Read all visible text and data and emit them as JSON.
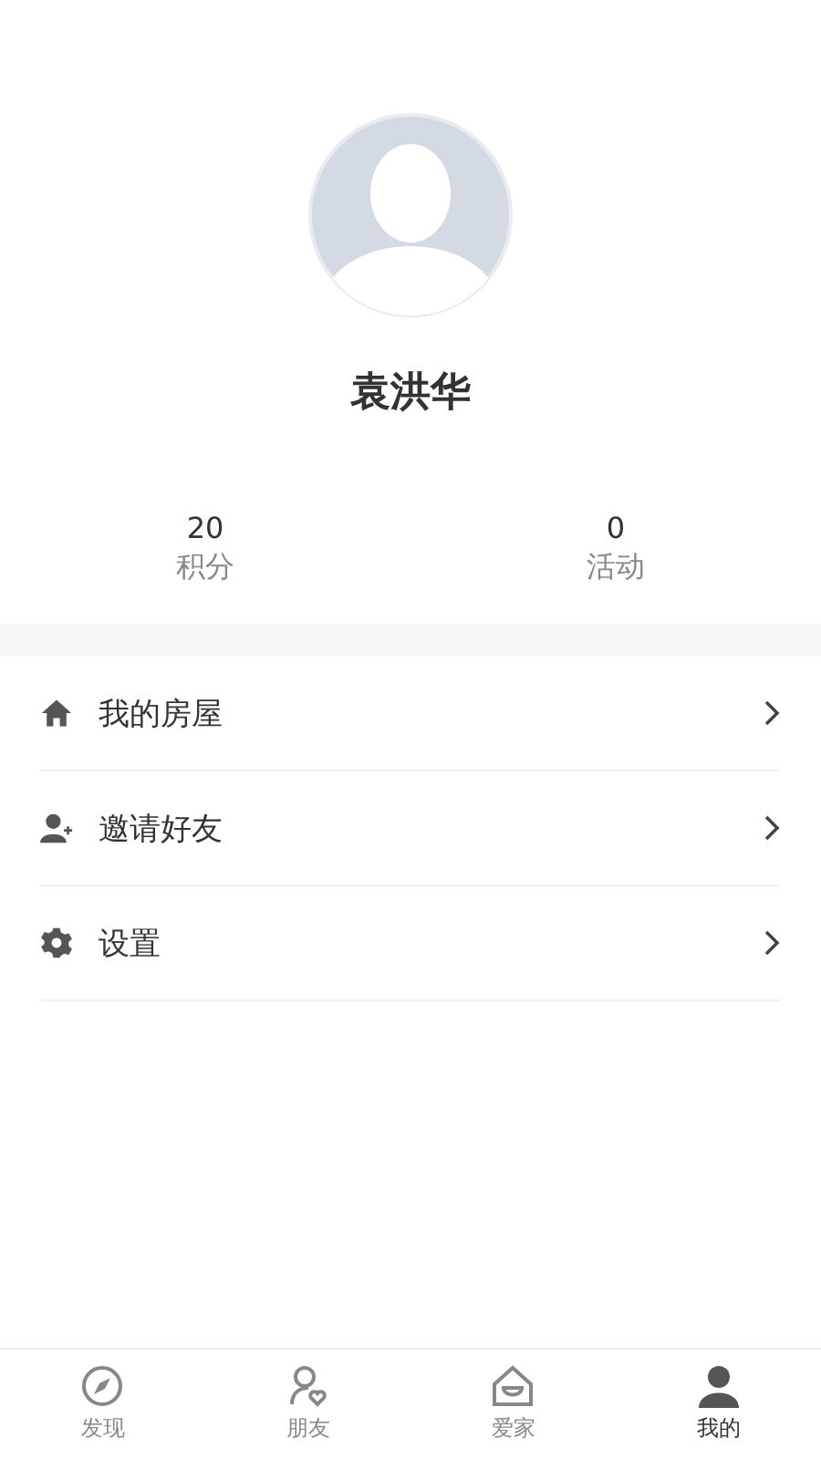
{
  "profile": {
    "name": "袁洪华"
  },
  "stats": [
    {
      "value": "20",
      "label": "积分"
    },
    {
      "value": "0",
      "label": "活动"
    }
  ],
  "menu": [
    {
      "kind": "home",
      "label": "我的房屋"
    },
    {
      "kind": "invite",
      "label": "邀请好友"
    },
    {
      "kind": "settings",
      "label": "设置"
    }
  ],
  "tabs": [
    {
      "kind": "discover",
      "label": "发现",
      "selected": false
    },
    {
      "kind": "friends",
      "label": "朋友",
      "selected": false
    },
    {
      "kind": "family",
      "label": "爱家",
      "selected": false
    },
    {
      "kind": "me",
      "label": "我的",
      "selected": true
    }
  ]
}
